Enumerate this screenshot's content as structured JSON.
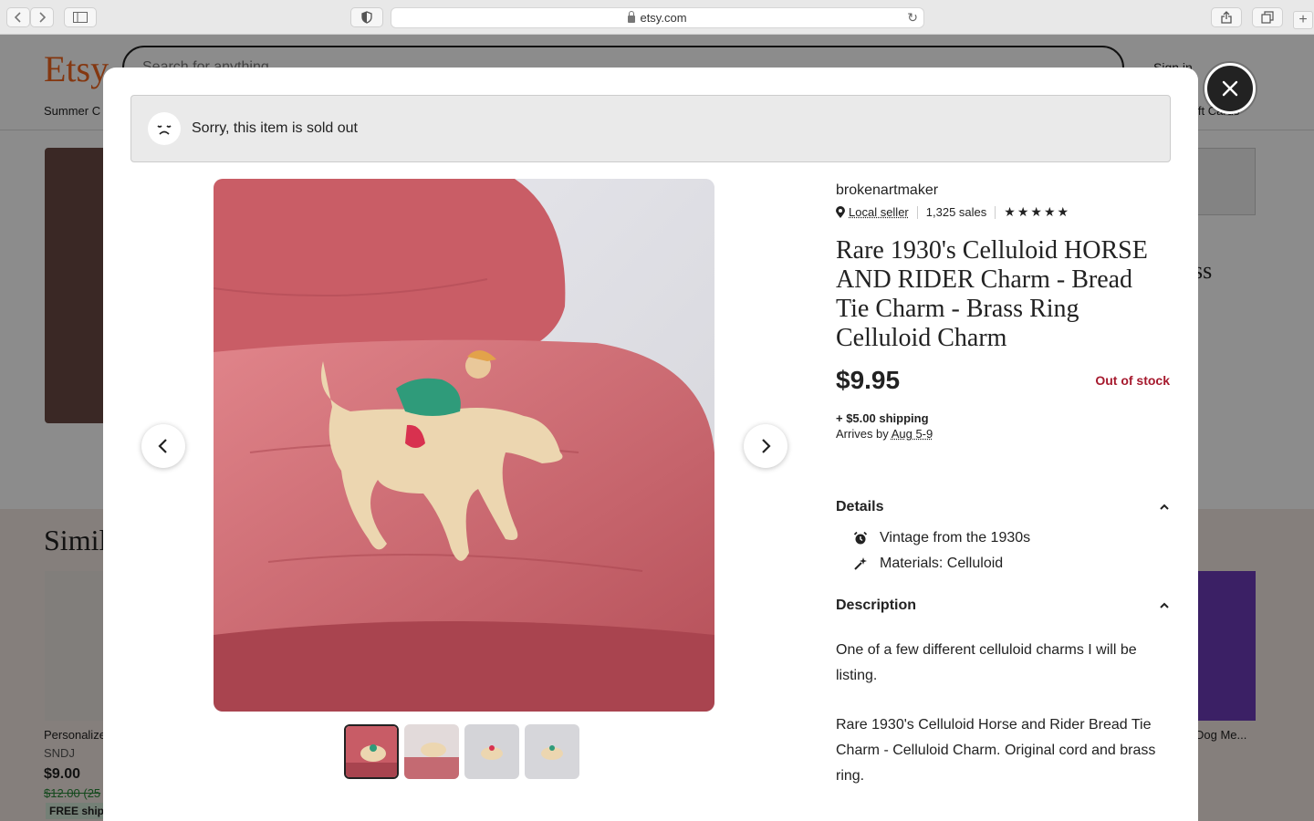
{
  "browser": {
    "url": "etsy.com"
  },
  "background": {
    "logo": "Etsy",
    "search_placeholder": "Search for anything",
    "sign_in": "Sign in",
    "category": "Summer C",
    "gift_cards": "ift Cards",
    "partial_heading_right": "ss",
    "similar_heading": "Simil",
    "card_left": {
      "title": "Personalize",
      "shop": "SNDJ",
      "price": "$9.00",
      "old_price": "$12.00 (25",
      "badge": "FREE shipp"
    },
    "card_right": {
      "title": "Dog Me..."
    }
  },
  "modal": {
    "sold_out_message": "Sorry, this item is sold out",
    "shop_name": "brokenartmaker",
    "local_seller": "Local seller",
    "sales": "1,325 sales",
    "rating_stars": 5,
    "title": "Rare 1930's Celluloid HORSE AND RIDER Charm - Bread Tie Charm - Brass Ring Celluloid Charm",
    "price": "$9.95",
    "stock_status": "Out of stock",
    "shipping": "+ $5.00 shipping",
    "arrives_label": "Arrives by",
    "arrives_date": "Aug 5-9",
    "details_heading": "Details",
    "details": [
      {
        "icon": "alarm-clock-icon",
        "text": "Vintage from the 1930s"
      },
      {
        "icon": "sparkle-icon",
        "text": "Materials: Celluloid"
      }
    ],
    "description_heading": "Description",
    "description_1": "One of a few different celluloid charms I will be listing.",
    "description_2": "Rare 1930's Celluloid Horse and Rider Bread Tie Charm - Celluloid Charm. Original cord and brass ring.",
    "thumbnail_count": 4
  },
  "colors": {
    "etsy_orange": "#f1641e",
    "out_of_stock_red": "#a61a2e",
    "banner_gray": "#eaeaea"
  }
}
